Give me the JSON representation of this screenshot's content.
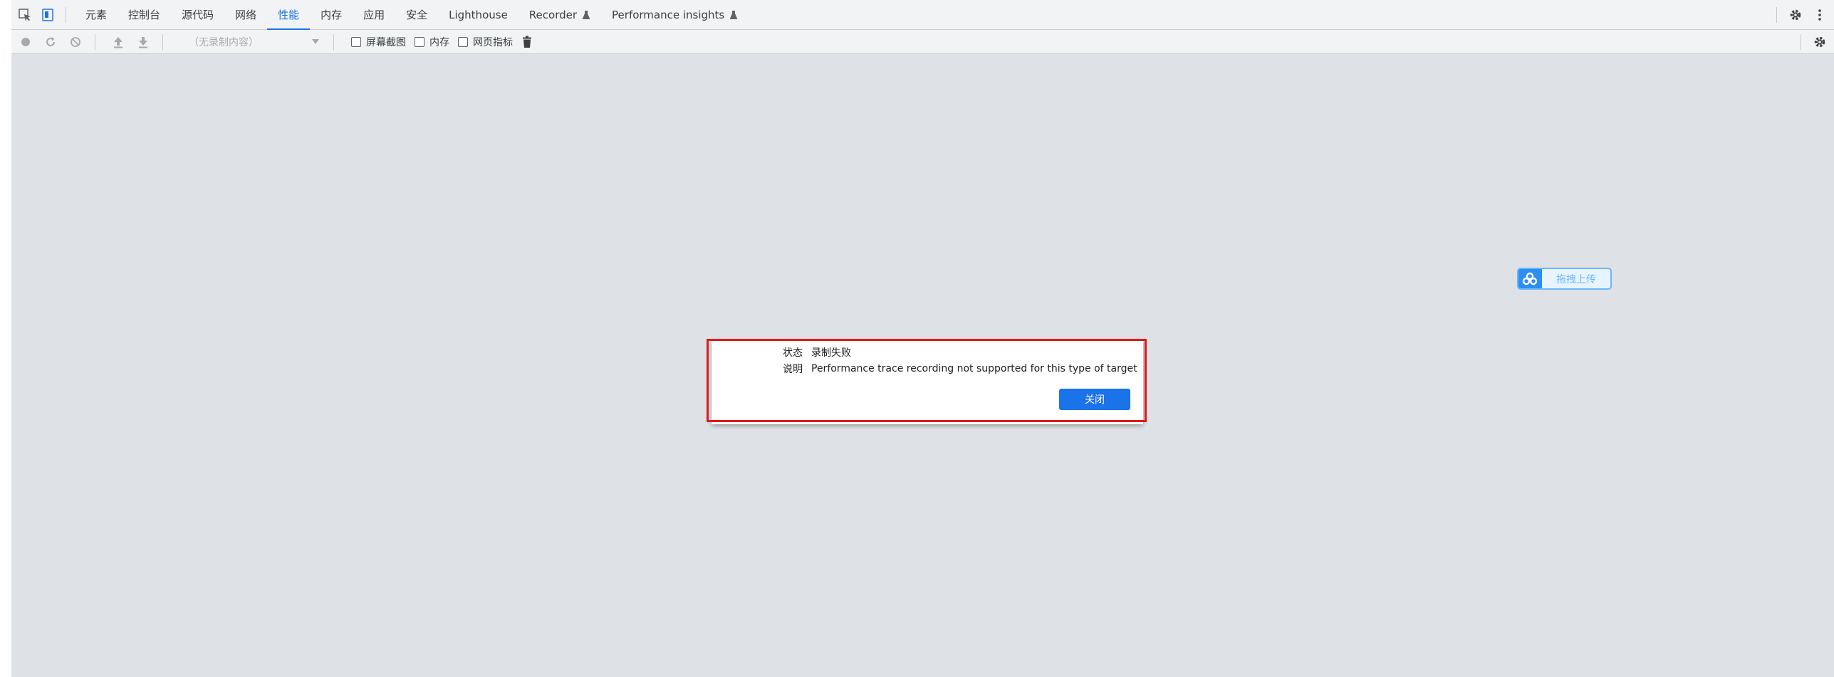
{
  "tabbar": {
    "tabs": [
      {
        "label": "元素"
      },
      {
        "label": "控制台"
      },
      {
        "label": "源代码"
      },
      {
        "label": "网络"
      },
      {
        "label": "性能",
        "active": true
      },
      {
        "label": "内存"
      },
      {
        "label": "应用"
      },
      {
        "label": "安全"
      },
      {
        "label": "Lighthouse"
      },
      {
        "label": "Recorder"
      },
      {
        "label": "Performance insights"
      }
    ],
    "icons": [
      "inspect-element-icon",
      "device-toolbar-icon",
      "flask-icon",
      "gear-icon",
      "kebab-menu-icon"
    ]
  },
  "toolbar": {
    "recording_select": "（无录制内容）",
    "checkboxes": [
      {
        "label": "屏幕截图",
        "checked": false
      },
      {
        "label": "内存",
        "checked": false
      },
      {
        "label": "网页指标",
        "checked": false
      }
    ],
    "icons": [
      "record-icon",
      "reload-icon",
      "clear-icon",
      "upload-icon",
      "download-icon",
      "trash-icon",
      "gear-icon"
    ]
  },
  "dialog": {
    "status_label": "状态",
    "status_value": "录制失败",
    "desc_label": "说明",
    "desc_value": "Performance trace recording not supported for this type of target",
    "close_label": "关闭"
  },
  "upload_widget": {
    "label": "拖拽上传"
  },
  "colors": {
    "accent": "#1a73e8",
    "panel_bg": "#dee1e6",
    "highlight": "#e01a1a",
    "upload": "#2c8ef3"
  }
}
